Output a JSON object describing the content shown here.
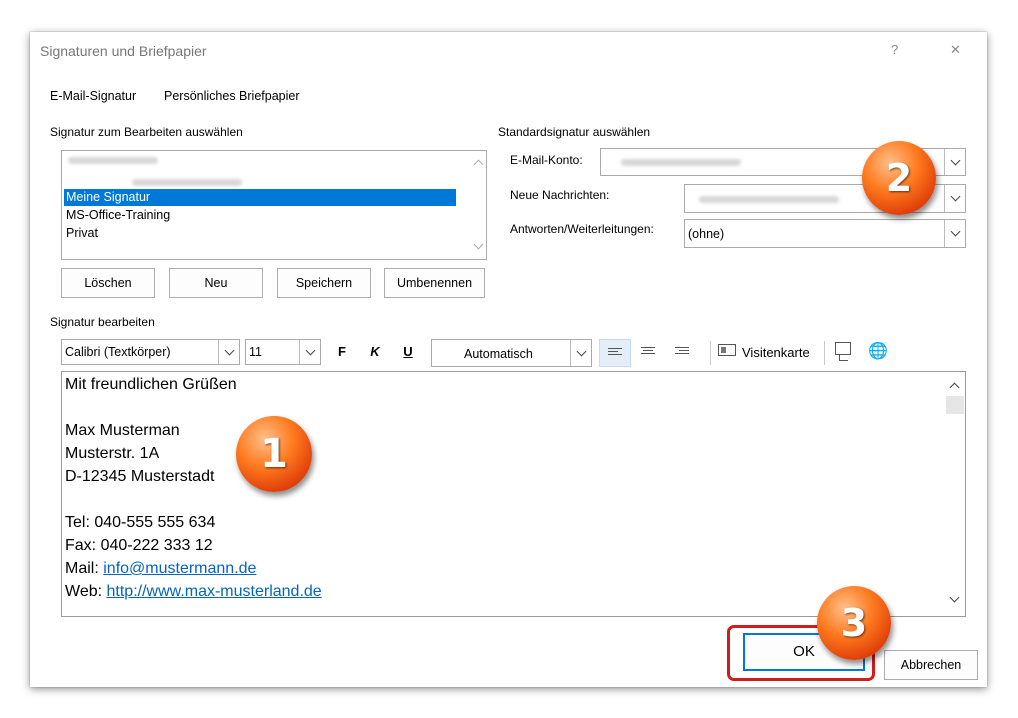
{
  "window": {
    "title": "Signaturen und Briefpapier",
    "help_glyph": "?",
    "close_glyph": "✕"
  },
  "tabs": [
    {
      "label": "E-Mail-Signatur"
    },
    {
      "label": "Persönliches Briefpapier"
    }
  ],
  "left": {
    "heading": "Signatur zum Bearbeiten auswählen",
    "items": [
      "Meine Signatur",
      "MS-Office-Training",
      "Privat"
    ],
    "selected_index": 0,
    "buttons": {
      "delete": "Löschen",
      "new": "Neu",
      "save": "Speichern",
      "rename": "Umbenennen"
    }
  },
  "right": {
    "heading": "Standardsignatur auswählen",
    "account_label": "E-Mail-Konto:",
    "new_messages_label": "Neue Nachrichten:",
    "replies_label": "Antworten/Weiterleitungen:",
    "replies_value": "(ohne)"
  },
  "editor": {
    "heading": "Signatur bearbeiten",
    "font": "Calibri (Textkörper)",
    "size": "11",
    "bold": "F",
    "italic": "K",
    "underline": "U",
    "color": "Automatisch",
    "business_card": "Visitenkarte",
    "lines": {
      "greeting": "Mit freundlichen Grüßen",
      "name": "Max Musterman",
      "street": "Musterstr. 1A",
      "city": "D-12345 Musterstadt",
      "tel": "Tel: 040-555 555 634",
      "fax": "Fax: 040-222 333 12",
      "mail_label": "Mail: ",
      "mail_link": "info@mustermann.de",
      "web_label": "Web: ",
      "web_link": "http://www.max-musterland.de"
    }
  },
  "footer": {
    "ok": "OK",
    "cancel": "Abbrechen"
  },
  "callouts": [
    "1",
    "2",
    "3"
  ],
  "colors": {
    "selection": "#0078d7",
    "callout": "#e8501a",
    "highlight_border": "#d01c1c",
    "link": "#0563c1"
  }
}
